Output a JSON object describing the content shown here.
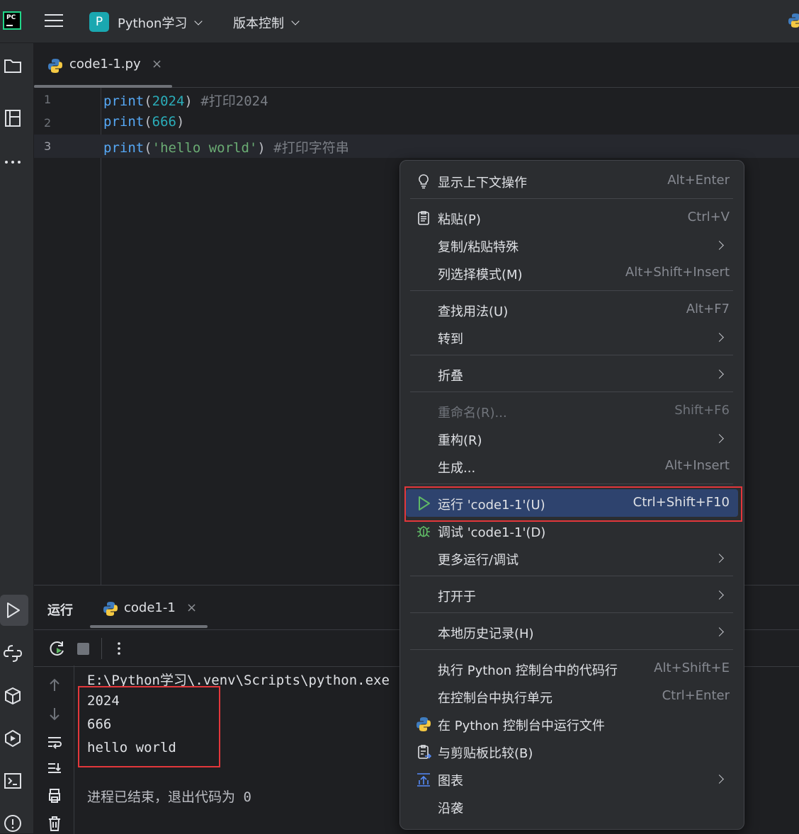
{
  "header": {
    "project_badge": "P",
    "project_name": "Python学习",
    "vcs_label": "版本控制"
  },
  "editor": {
    "tab_label": "code1-1.py",
    "tab_close": "×",
    "lines": [
      {
        "num": "1",
        "parts": [
          {
            "t": "print",
            "c": "fn"
          },
          {
            "t": "(",
            "c": "par"
          },
          {
            "t": "2024",
            "c": "num"
          },
          {
            "t": ") ",
            "c": "par"
          },
          {
            "t": "#打印2024",
            "c": "cmt"
          }
        ]
      },
      {
        "num": "2",
        "parts": [
          {
            "t": "print",
            "c": "fn"
          },
          {
            "t": "(",
            "c": "par"
          },
          {
            "t": "666",
            "c": "num"
          },
          {
            "t": ")",
            "c": "par"
          }
        ]
      },
      {
        "num": "3",
        "parts": [
          {
            "t": "print",
            "c": "fn"
          },
          {
            "t": "(",
            "c": "par"
          },
          {
            "t": "'hello world'",
            "c": "str"
          },
          {
            "t": ") ",
            "c": "par"
          },
          {
            "t": "#打印字符串",
            "c": "cmt"
          }
        ]
      }
    ],
    "current_line": 3
  },
  "run_panel": {
    "title": "运行",
    "tab_label": "code1-1",
    "tab_close": "×",
    "console": {
      "command": "E:\\Python学习\\.venv\\Scripts\\python.exe",
      "output": [
        "2024",
        "666",
        "hello world"
      ],
      "exit_message": "进程已结束，退出代码为 0"
    }
  },
  "context_menu": {
    "items": [
      {
        "label": "显示上下文操作",
        "shortcut": "Alt+Enter",
        "icon": "bulb-icon"
      },
      {
        "sep": true
      },
      {
        "label": "粘贴(P)",
        "shortcut": "Ctrl+V",
        "icon": "clipboard-icon"
      },
      {
        "label": "复制/粘贴特殊",
        "submenu": true
      },
      {
        "label": "列选择模式(M)",
        "shortcut": "Alt+Shift+Insert"
      },
      {
        "sep": true
      },
      {
        "label": "查找用法(U)",
        "shortcut": "Alt+F7"
      },
      {
        "label": "转到",
        "submenu": true
      },
      {
        "sep": true
      },
      {
        "label": "折叠",
        "submenu": true
      },
      {
        "sep": true
      },
      {
        "label": "重命名(R)...",
        "shortcut": "Shift+F6",
        "disabled": true
      },
      {
        "label": "重构(R)",
        "submenu": true
      },
      {
        "label": "生成...",
        "shortcut": "Alt+Insert"
      },
      {
        "sep": true
      },
      {
        "label": "运行 'code1-1'(U)",
        "shortcut": "Ctrl+Shift+F10",
        "icon": "run-icon",
        "selected": true
      },
      {
        "label": "调试 'code1-1'(D)",
        "icon": "debug-icon"
      },
      {
        "label": "更多运行/调试",
        "submenu": true
      },
      {
        "sep": true
      },
      {
        "label": "打开于",
        "submenu": true
      },
      {
        "sep": true
      },
      {
        "label": "本地历史记录(H)",
        "submenu": true
      },
      {
        "sep": true
      },
      {
        "label": "执行 Python 控制台中的代码行",
        "shortcut": "Alt+Shift+E"
      },
      {
        "label": "在控制台中执行单元",
        "shortcut": "Ctrl+Enter"
      },
      {
        "label": "在 Python 控制台中运行文件",
        "icon": "python-icon"
      },
      {
        "label": "与剪贴板比较(B)",
        "icon": "compare-icon"
      },
      {
        "label": "图表",
        "submenu": true,
        "icon": "diagram-icon"
      },
      {
        "label": "沿袭"
      }
    ]
  },
  "colors": {
    "highlight_box": "#e3373b",
    "selected_item_bg": "#2e436e",
    "run_green": "#5fb865"
  }
}
